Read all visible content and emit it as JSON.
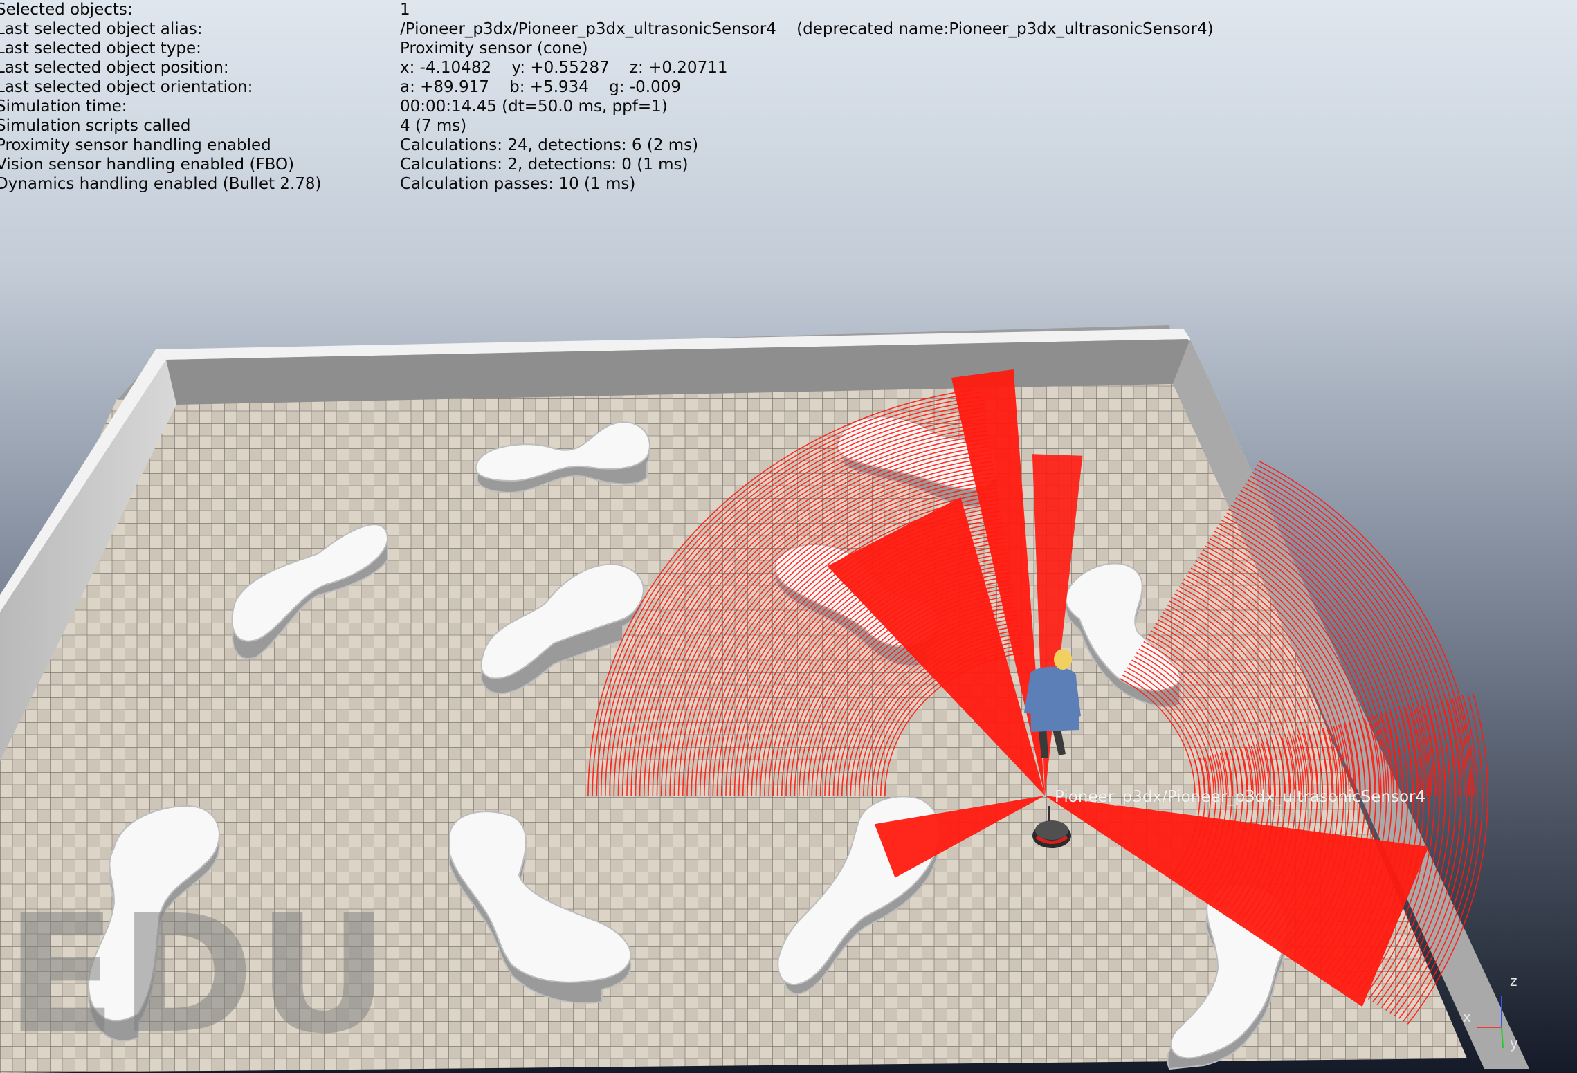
{
  "hud": {
    "rows": [
      {
        "label": "Selected objects:",
        "value": "1"
      },
      {
        "label": "Last selected object alias:",
        "value": "/Pioneer_p3dx/Pioneer_p3dx_ultrasonicSensor4    (deprecated name:Pioneer_p3dx_ultrasonicSensor4)"
      },
      {
        "label": "Last selected object type:",
        "value": "Proximity sensor (cone)"
      },
      {
        "label": "Last selected object position:",
        "value": "x: -4.10482    y: +0.55287    z: +0.20711"
      },
      {
        "label": "Last selected object orientation:",
        "value": "a: +89.917    b: +5.934    g: -0.009"
      },
      {
        "label": "Simulation time:",
        "value": "00:00:14.45 (dt=50.0 ms, ppf=1)"
      },
      {
        "label": "Simulation scripts called",
        "value": "4 (7 ms)"
      },
      {
        "label": "Proximity sensor handling enabled",
        "value": "Calculations: 24, detections: 6 (2 ms)"
      },
      {
        "label": "Vision sensor handling enabled (FBO)",
        "value": "Calculations: 2, detections: 0 (1 ms)"
      },
      {
        "label": "Dynamics handling enabled (Bullet 2.78)",
        "value": "Calculation passes: 10 (1 ms)"
      }
    ]
  },
  "scene": {
    "selected_object_label": "Pioneer_p3dx/Pioneer_p3dx_ultrasonicSensor4",
    "watermark": "EDU",
    "axes": {
      "x": "x",
      "y": "y",
      "z": "z"
    },
    "colors": {
      "background_top": "#dfe6ee",
      "background_bottom": "#141a27",
      "floor_light": "#ddd4c8",
      "floor_dark": "#c9c0b4",
      "wall": "#f2f2f2",
      "obstacle": "#f8f8f8",
      "sensor_beam": "#ff1a10",
      "robot": "#2a2a2a",
      "person_shirt": "#5d7fb8",
      "person_hair": "#f0d060"
    }
  }
}
